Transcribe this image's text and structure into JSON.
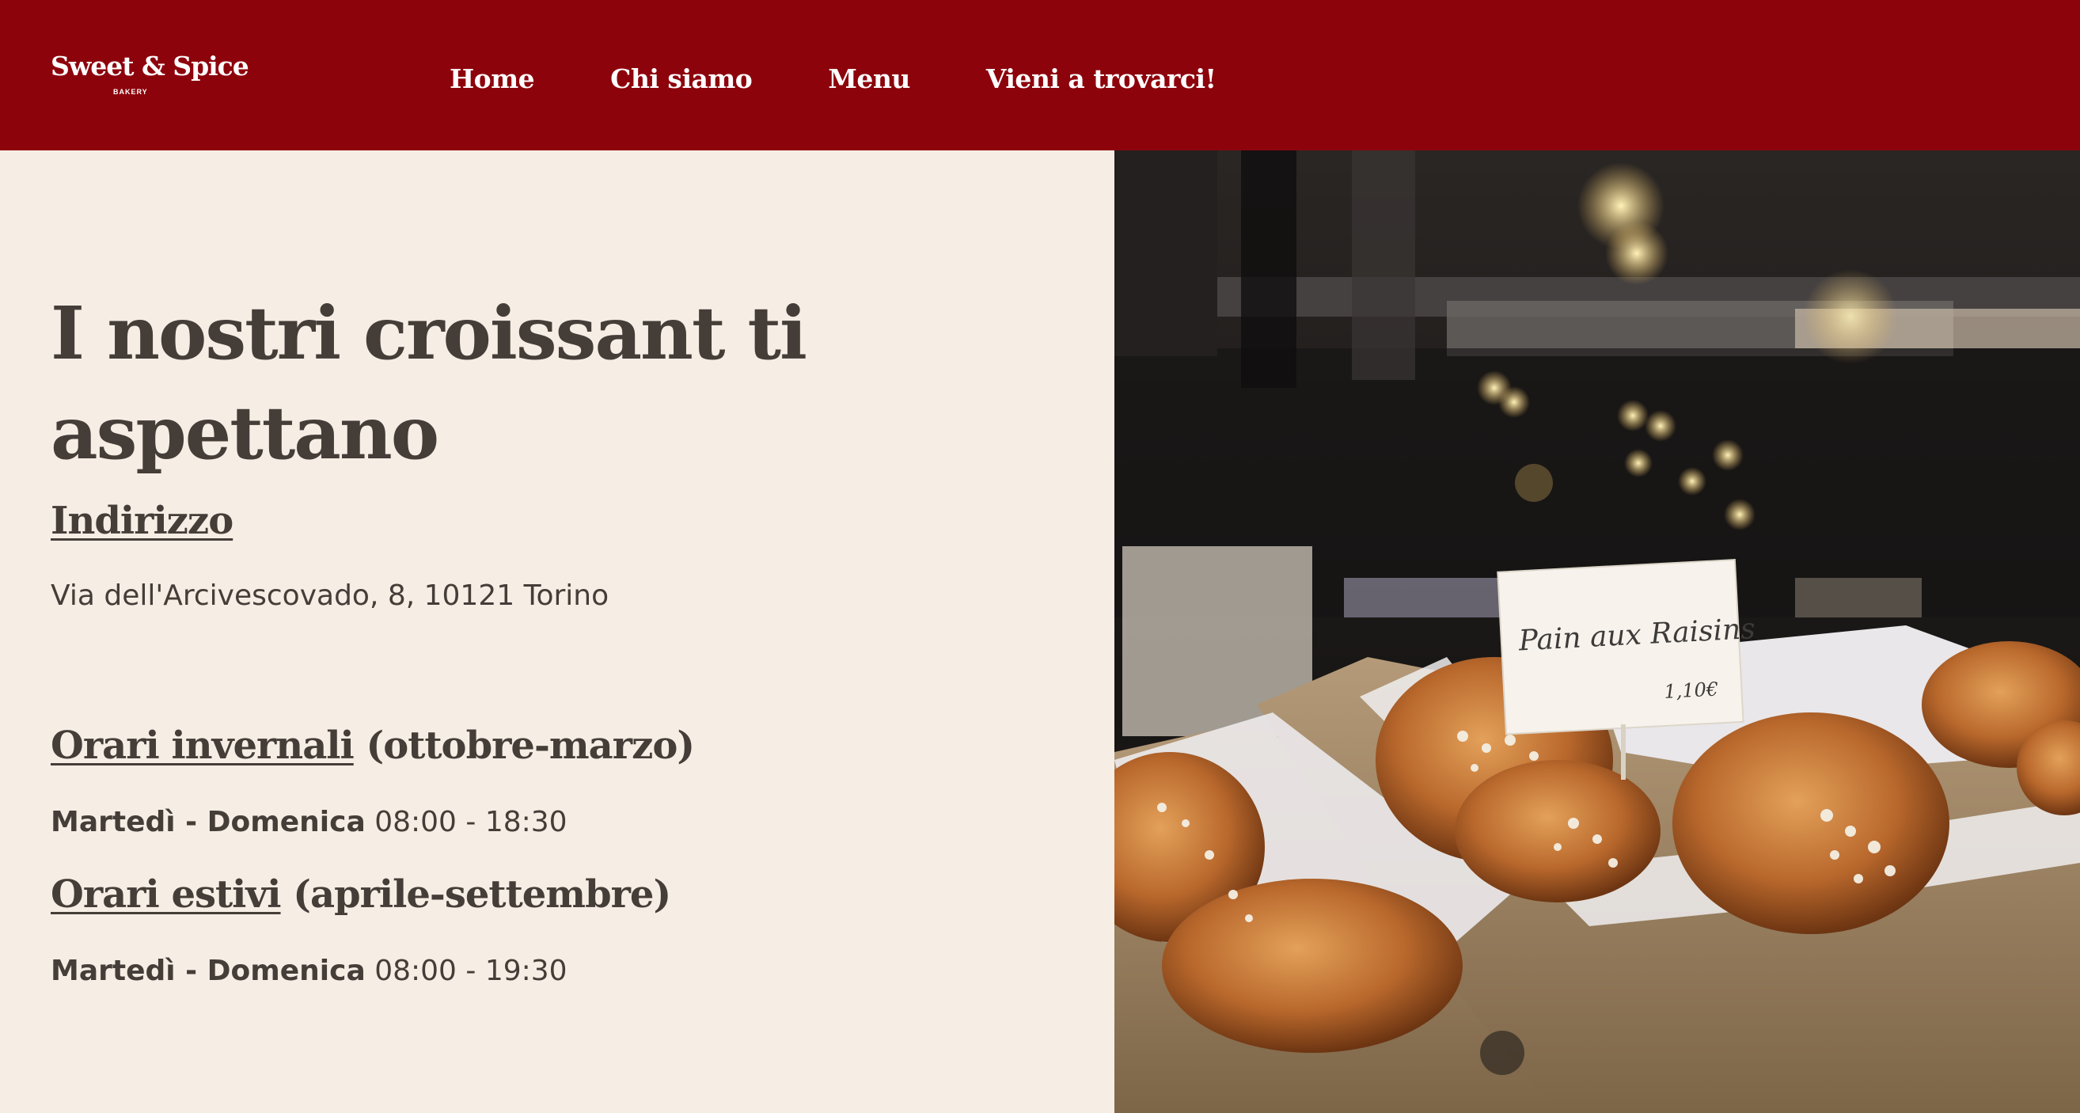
{
  "header": {
    "logo": {
      "main": "Sweet & Spice",
      "sub": "BAKERY"
    },
    "nav": [
      {
        "label": "Home"
      },
      {
        "label": "Chi siamo"
      },
      {
        "label": "Menu"
      },
      {
        "label": "Vieni a trovarci!"
      }
    ],
    "background_color": "#8d030c"
  },
  "main": {
    "title": "I nostri croissant ti aspettano",
    "address_heading": "Indirizzo",
    "address": "Via dell'Arcivescovado, 8, 10121 Torino",
    "winter": {
      "heading": "Orari invernali",
      "period": "(ottobre-marzo)",
      "days": "Martedì - Domenica",
      "hours": "08:00 - 18:30"
    },
    "summer": {
      "heading": "Orari estivi",
      "period": "(aprile-settembre)",
      "days": "Martedì - Domenica",
      "hours": "08:00 - 19:30"
    }
  },
  "photo": {
    "sign_text": "Pain aux Raisins",
    "sign_price": "1,10€"
  },
  "colors": {
    "brand_red": "#8d030c",
    "page_background": "#f6ede5",
    "text": "#453d38"
  }
}
